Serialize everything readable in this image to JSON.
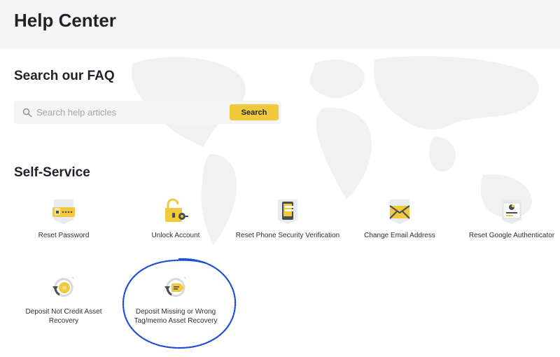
{
  "header": {
    "title": "Help Center"
  },
  "faq": {
    "title": "Search our FAQ",
    "search_placeholder": "Search help articles",
    "search_button": "Search"
  },
  "self_service": {
    "title": "Self-Service",
    "items": [
      {
        "label": "Reset Password",
        "icon": "reset-password-icon"
      },
      {
        "label": "Unlock Account",
        "icon": "unlock-account-icon"
      },
      {
        "label": "Reset Phone Security Verification",
        "icon": "phone-verification-icon"
      },
      {
        "label": "Change Email Address",
        "icon": "email-icon"
      },
      {
        "label": "Reset Google Authenticator",
        "icon": "authenticator-icon"
      },
      {
        "label": "Deposit Not Credit Asset Recovery",
        "icon": "coin-recovery-icon"
      },
      {
        "label": "Deposit Missing or Wrong Tag/memo Asset Recovery",
        "icon": "tag-recovery-icon"
      }
    ]
  },
  "colors": {
    "accent": "#f0c93d",
    "annotation": "#1d4fd8"
  }
}
